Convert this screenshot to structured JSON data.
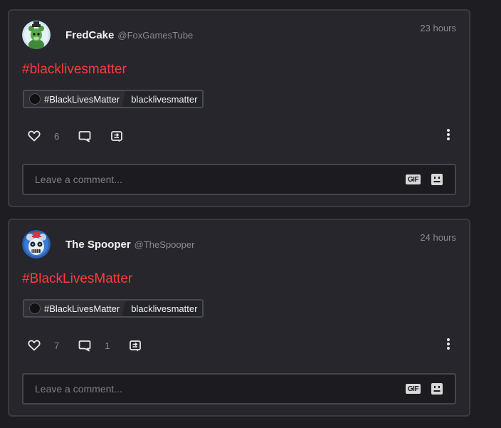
{
  "posts": [
    {
      "display_name": "FredCake",
      "handle": "@FoxGamesTube",
      "time": "23 hours",
      "text": "#blacklivesmatter",
      "tag_label": "#BlackLivesMatter",
      "tag_slug": "blacklivesmatter",
      "likes": "6",
      "comments": "",
      "comment_placeholder": "Leave a comment...",
      "gif_label": "GIF",
      "avatar_icon": "green-animatronic-avatar"
    },
    {
      "display_name": "The Spooper",
      "handle": "@TheSpooper",
      "time": "24 hours",
      "text": "#BlackLivesMatter",
      "tag_label": "#BlackLivesMatter",
      "tag_slug": "blacklivesmatter",
      "likes": "7",
      "comments": "1",
      "comment_placeholder": "Leave a comment...",
      "gif_label": "GIF",
      "avatar_icon": "blue-animatronic-avatar"
    }
  ],
  "colors": {
    "background": "#1e1e22",
    "card": "#26262c",
    "card_border": "#3a3a42",
    "hashtag": "#ff3b3b",
    "muted": "#8a8a92"
  }
}
